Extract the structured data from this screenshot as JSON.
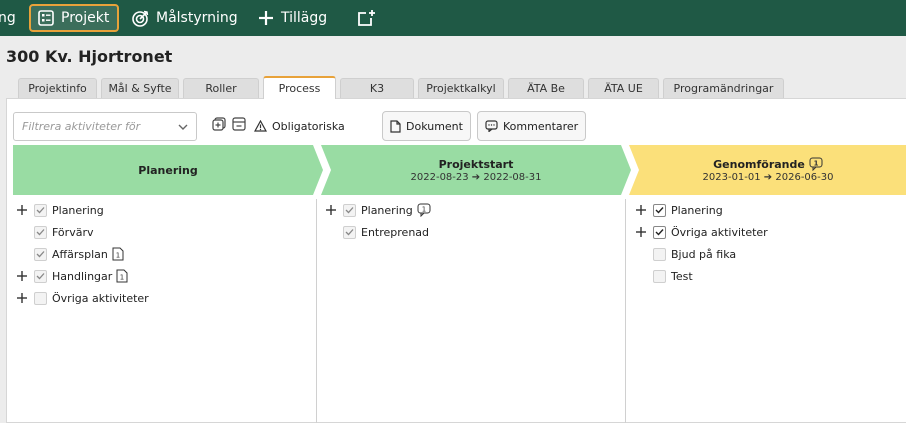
{
  "nav": {
    "cut_label": "ng",
    "items": [
      {
        "label": "Projekt",
        "icon": "clipboard-list-icon"
      },
      {
        "label": "Målstyrning",
        "icon": "target-icon"
      },
      {
        "label": "Tillägg",
        "icon": "plus-icon"
      },
      {
        "label": "",
        "icon": "new-tab-icon"
      }
    ]
  },
  "project": {
    "title": "300 Kv. Hjortronet"
  },
  "tabs": [
    "Projektinfo",
    "Mål & Syfte",
    "Roller",
    "Process",
    "K3",
    "Projektkalkyl",
    "ÄTA Be",
    "ÄTA UE",
    "Programändringar"
  ],
  "active_tab": "Process",
  "toolbar": {
    "filter_placeholder": "Filtrera aktiviteter för",
    "mandatory_label": "Obligatoriska",
    "document_label": "Dokument",
    "comments_label": "Kommentarer"
  },
  "phases": [
    {
      "title": "Planering",
      "dates": "",
      "color": "#99dca3",
      "badge": ""
    },
    {
      "title": "Projektstart",
      "dates": "2022-08-23 ➔ 2022-08-31",
      "color": "#99dca3",
      "badge": ""
    },
    {
      "title": "Genomförande",
      "dates": "2023-01-01 ➔ 2026-06-30",
      "color": "#fbe07a",
      "badge": "1"
    }
  ],
  "columns": [
    {
      "rows": [
        {
          "label": "Planering",
          "expand": true,
          "checked": true
        },
        {
          "label": "Förvärv",
          "expand": false,
          "checked": true
        },
        {
          "label": "Affärsplan",
          "expand": false,
          "checked": true,
          "doc_badge": "1"
        },
        {
          "label": "Handlingar",
          "expand": true,
          "checked": true,
          "doc_badge": "1"
        },
        {
          "label": "Övriga aktiviteter",
          "expand": true,
          "checked": false
        }
      ]
    },
    {
      "rows": [
        {
          "label": "Planering",
          "expand": true,
          "checked": true,
          "comment_badge": "1"
        },
        {
          "label": "Entreprenad",
          "expand": false,
          "checked": true
        }
      ]
    },
    {
      "rows": [
        {
          "label": "Planering",
          "expand": true,
          "checked": true
        },
        {
          "label": "Övriga aktiviteter",
          "expand": true,
          "checked": true
        },
        {
          "label": "Bjud på fika",
          "expand": false,
          "checked": false
        },
        {
          "label": "Test",
          "expand": false,
          "checked": false
        }
      ]
    }
  ]
}
